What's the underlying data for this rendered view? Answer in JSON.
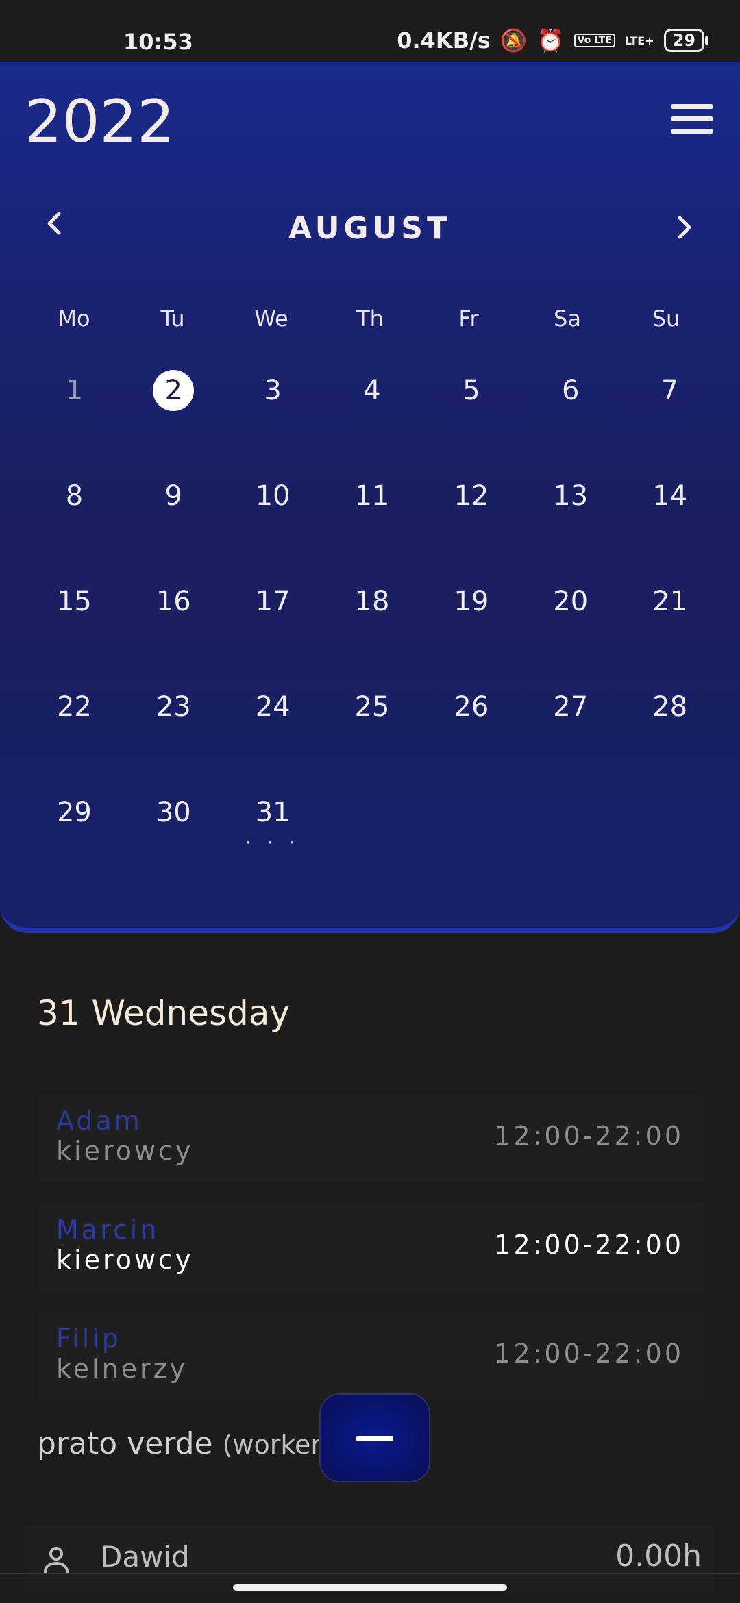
{
  "status_bar": {
    "time": "10:53",
    "net_speed": "0.4KB/s",
    "volte_label": "Vo LTE",
    "lte_label": "LTE+",
    "battery": "29"
  },
  "header": {
    "year": "2022"
  },
  "calendar": {
    "month": "AUGUST",
    "weekdays": [
      "Mo",
      "Tu",
      "We",
      "Th",
      "Fr",
      "Sa",
      "Su"
    ],
    "weeks": [
      [
        "1",
        "2",
        "3",
        "4",
        "5",
        "6",
        "7"
      ],
      [
        "8",
        "9",
        "10",
        "11",
        "12",
        "13",
        "14"
      ],
      [
        "15",
        "16",
        "17",
        "18",
        "19",
        "20",
        "21"
      ],
      [
        "22",
        "23",
        "24",
        "25",
        "26",
        "27",
        "28"
      ],
      [
        "29",
        "30",
        "31",
        "",
        "",
        "",
        ""
      ]
    ],
    "selected_day": "2",
    "marker": "· · ·"
  },
  "day_view": {
    "heading": "31 Wednesday",
    "shifts": [
      {
        "name": "Adam",
        "role": "kierowcy",
        "time": "12:00-22:00"
      },
      {
        "name": "Marcin",
        "role": "kierowcy",
        "time": "12:00-22:00"
      },
      {
        "name": "Filip",
        "role": "kelnerzy",
        "time": "12:00-22:00"
      }
    ],
    "workplace": "prato verde",
    "workplace_sub": "(workers"
  },
  "workers": [
    {
      "name": "Dawid",
      "hours": "0.00h"
    }
  ],
  "colors": {
    "accent": "#1a2a8c",
    "background": "#1c1c1c",
    "heading": "#f6ead8"
  }
}
